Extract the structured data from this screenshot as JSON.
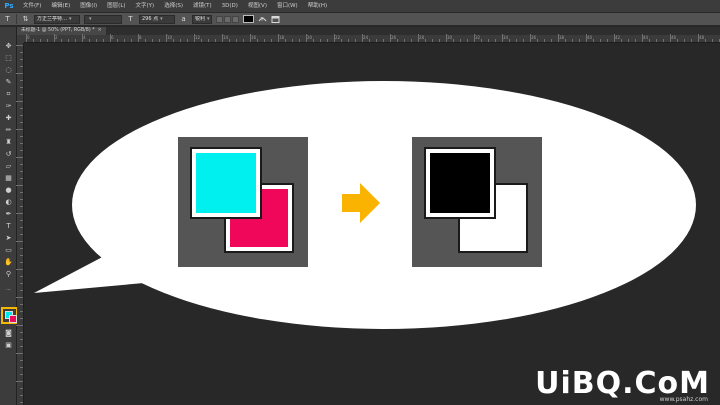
{
  "app": {
    "logo": "Ps"
  },
  "menu": [
    "文件(F)",
    "编辑(E)",
    "图像(I)",
    "图层(L)",
    "文字(Y)",
    "选择(S)",
    "滤镜(T)",
    "3D(D)",
    "视图(V)",
    "窗口(W)",
    "帮助(H)"
  ],
  "options": {
    "tool_icon": "T",
    "orient_icon": "⇅",
    "font_family": "方正兰亭特…",
    "font_style": "",
    "size_icon": "T",
    "font_size": "296 点",
    "aa_icon": "a",
    "aa_mode": "锐利",
    "text_color": "#000000"
  },
  "document": {
    "tab_title": "未标题-1 @ 50% (PPT, RGB/8) *",
    "close": "×"
  },
  "ruler": {
    "labels": [
      "0",
      "2",
      "4",
      "6",
      "8",
      "10",
      "12",
      "14",
      "16",
      "18",
      "20",
      "22",
      "24",
      "26",
      "28",
      "30",
      "32",
      "34",
      "36",
      "38",
      "40",
      "42",
      "44",
      "46",
      "48"
    ]
  },
  "illustration": {
    "before": {
      "fg_color": "#00efef",
      "bg_color": "#f0075a"
    },
    "after": {
      "fg_color": "#000000",
      "bg_color": "#ffffff"
    },
    "arrow_color": "#f9b300"
  },
  "watermark": {
    "main": "UiBQ.CoM",
    "sub": "www.psahz.com"
  },
  "colors": {
    "highlight": "#f5b800",
    "accent": "#31a8ff"
  }
}
